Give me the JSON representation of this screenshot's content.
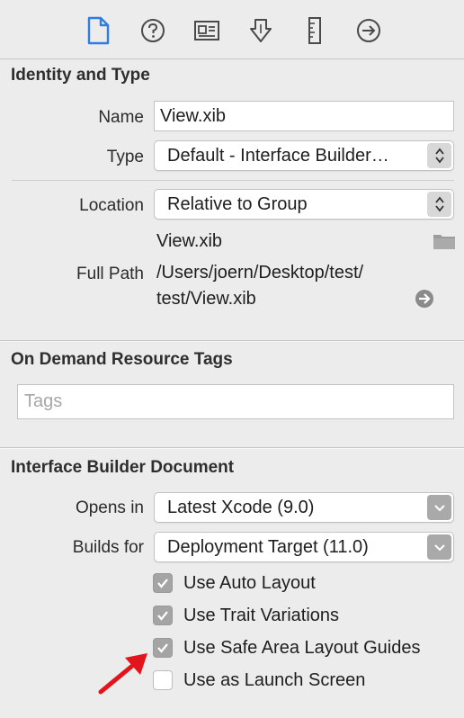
{
  "toolbar": {
    "icons": [
      {
        "name": "file-inspector-icon",
        "active": true
      },
      {
        "name": "quick-help-icon",
        "active": false
      },
      {
        "name": "identity-inspector-icon",
        "active": false
      },
      {
        "name": "attributes-inspector-icon",
        "active": false
      },
      {
        "name": "size-inspector-icon",
        "active": false
      },
      {
        "name": "connections-inspector-icon",
        "active": false
      }
    ],
    "active_color": "#2f7de1"
  },
  "identity": {
    "title": "Identity and Type",
    "name_label": "Name",
    "name_value": "View.xib",
    "type_label": "Type",
    "type_value": "Default - Interface Builder…",
    "location_label": "Location",
    "location_value": "Relative to Group",
    "location_file": "View.xib",
    "full_path_label": "Full Path",
    "full_path_line1": "/Users/joern/Desktop/test/",
    "full_path_line2": "test/View.xib"
  },
  "odr": {
    "title": "On Demand Resource Tags",
    "tags_placeholder": "Tags"
  },
  "ib_document": {
    "title": "Interface Builder Document",
    "opens_in_label": "Opens in",
    "opens_in_value": "Latest Xcode (9.0)",
    "builds_for_label": "Builds for",
    "builds_for_value": "Deployment Target (11.0)",
    "checkboxes": [
      {
        "label": "Use Auto Layout",
        "checked": true
      },
      {
        "label": "Use Trait Variations",
        "checked": true
      },
      {
        "label": "Use Safe Area Layout Guides",
        "checked": true
      },
      {
        "label": "Use as Launch Screen",
        "checked": false
      }
    ]
  },
  "annotation": {
    "color": "#e3141b",
    "target": "Use Safe Area Layout Guides"
  }
}
